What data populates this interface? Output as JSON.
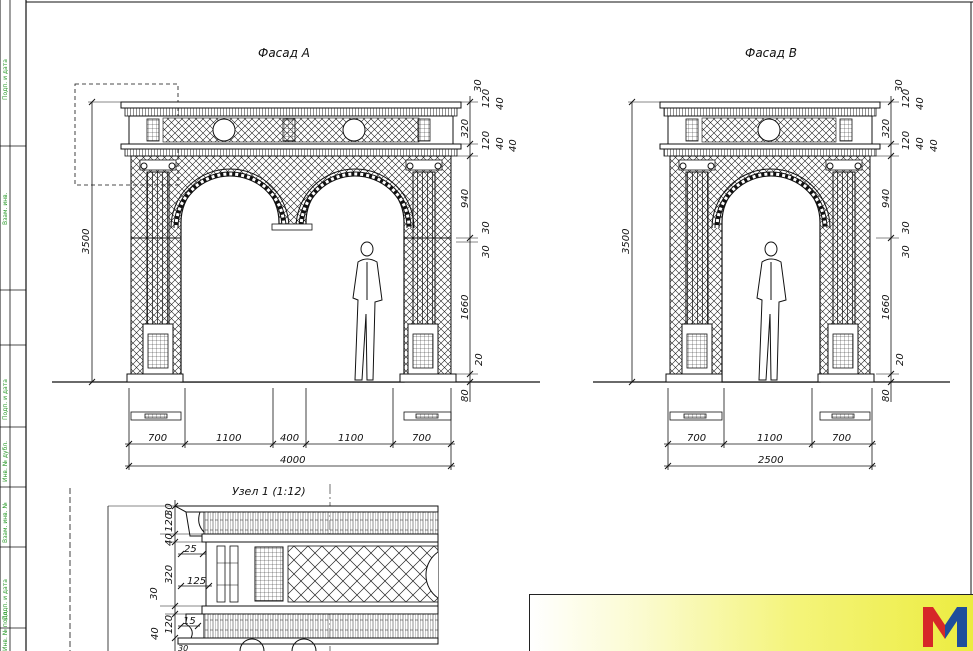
{
  "facade_a": {
    "title": "Фасад А",
    "height_total": "3500",
    "width_dims": [
      "700",
      "1100",
      "400",
      "1100",
      "700"
    ],
    "width_total": "4000",
    "vertical_dims": [
      "30",
      "120",
      "40",
      "320",
      "120",
      "40",
      "40",
      "940",
      "30",
      "30",
      "1660",
      "20",
      "80"
    ]
  },
  "facade_b": {
    "title": "Фасад В",
    "height_total": "3500",
    "width_dims": [
      "700",
      "1100",
      "700"
    ],
    "width_total": "2500",
    "vertical_dims": [
      "30",
      "120",
      "40",
      "320",
      "120",
      "40",
      "40",
      "940",
      "30",
      "30",
      "1660",
      "20",
      "80"
    ]
  },
  "node1": {
    "title": "Узел 1 (1:12)",
    "vertical_dims": [
      "30",
      "120",
      "40",
      "320",
      "30",
      "120",
      "40",
      "30"
    ],
    "horizontal_dims": [
      "25",
      "125",
      "15"
    ]
  },
  "side_strip": {
    "labels": [
      "Подп. и дата",
      "Взам. инв.",
      "Подп. и дата",
      "Инв. № дубл.",
      "Взам. инв. №",
      "Подп. и дата",
      "Инв. № подл."
    ]
  },
  "logo": {
    "icon": "m-logo-icon",
    "colors": {
      "red": "#d62828",
      "blue": "#1f4e9c",
      "yellow": "#f2f24a"
    }
  }
}
